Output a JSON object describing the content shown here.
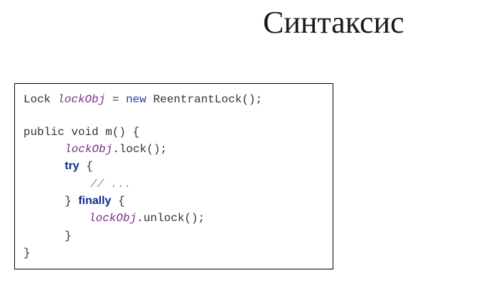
{
  "slide": {
    "title": "Синтаксис"
  },
  "code": {
    "line1": {
      "type": "Lock",
      "var": "lockObj",
      "assign": "=",
      "new_kw": "new",
      "rest": "ReentrantLock();"
    },
    "line3": {
      "text": "public void m() {"
    },
    "line4": {
      "var": "lockObj",
      "rest": ".lock();"
    },
    "line5": {
      "kw": "try",
      "rest": "{"
    },
    "line6": {
      "comment": "// ..."
    },
    "line7": {
      "close": "}",
      "kw": "finally",
      "rest": "{"
    },
    "line8": {
      "var": "lockObj",
      "rest": ".unlock();"
    },
    "line9": {
      "close": "}"
    },
    "line10": {
      "close": "}"
    }
  }
}
